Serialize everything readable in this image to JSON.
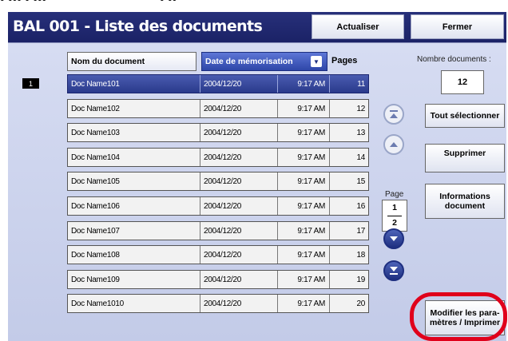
{
  "top_fragment": {
    "left_text": "• ••• • •••",
    "right_text": "• ••"
  },
  "header": {
    "title": "BAL 001 - Liste des documents",
    "refresh_label": "Actualiser",
    "close_label": "Fermer"
  },
  "columns": {
    "name_label": "Nom du document",
    "date_label": "Date de mémorisation",
    "pages_label": "Pages"
  },
  "selection_badge": "1",
  "documents": [
    {
      "name": "Doc Name101",
      "date": "2004/12/20",
      "time": "9:17 AM",
      "pages": "11",
      "selected": true
    },
    {
      "name": "Doc Name102",
      "date": "2004/12/20",
      "time": "9:17 AM",
      "pages": "12",
      "selected": false
    },
    {
      "name": "Doc Name103",
      "date": "2004/12/20",
      "time": "9:17 AM",
      "pages": "13",
      "selected": false
    },
    {
      "name": "Doc Name104",
      "date": "2004/12/20",
      "time": "9:17 AM",
      "pages": "14",
      "selected": false
    },
    {
      "name": "Doc Name105",
      "date": "2004/12/20",
      "time": "9:17 AM",
      "pages": "15",
      "selected": false
    },
    {
      "name": "Doc Name106",
      "date": "2004/12/20",
      "time": "9:17 AM",
      "pages": "16",
      "selected": false
    },
    {
      "name": "Doc Name107",
      "date": "2004/12/20",
      "time": "9:17 AM",
      "pages": "17",
      "selected": false
    },
    {
      "name": "Doc Name108",
      "date": "2004/12/20",
      "time": "9:17 AM",
      "pages": "18",
      "selected": false
    },
    {
      "name": "Doc Name109",
      "date": "2004/12/20",
      "time": "9:17 AM",
      "pages": "19",
      "selected": false
    },
    {
      "name": "Doc Name1010",
      "date": "2004/12/20",
      "time": "9:17 AM",
      "pages": "20",
      "selected": false
    }
  ],
  "pagination": {
    "label": "Page",
    "current": "1",
    "total": "2",
    "buttons": [
      "first-page",
      "previous-page",
      "next-page",
      "last-page"
    ]
  },
  "count": {
    "label": "Nombre documents :",
    "value": "12"
  },
  "actions": {
    "select_all": "Tout sélectionner",
    "delete": "Supprimer",
    "info": "Informations document",
    "modify_print": "Modifier les para- mètres / Imprimer"
  },
  "colors": {
    "header_bg": "#1b2266",
    "panel_bg": "#c9d0ec",
    "selected_row": "#2a3a8c",
    "highlight": "#e0001b"
  }
}
